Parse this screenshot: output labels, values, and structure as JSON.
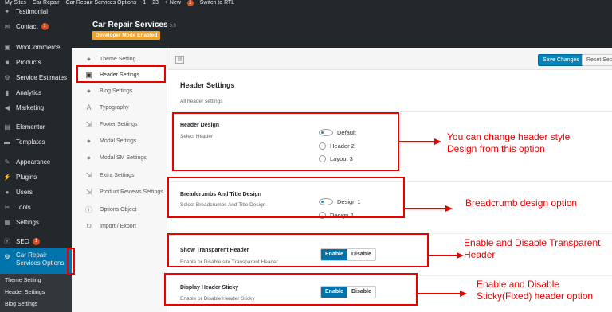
{
  "admin_bar": {
    "items": [
      "My Sites",
      "Car Repair",
      "Car Repair Services Options",
      "1",
      "23",
      "+ New",
      "1",
      "Switch to RTL"
    ]
  },
  "admin_menu": {
    "items": [
      {
        "label": "Testimonial",
        "icon": "pin-icon"
      },
      {
        "label": "Contact",
        "icon": "mail-icon",
        "badge": "1"
      },
      {
        "label": "WooCommerce",
        "icon": "woo-icon"
      },
      {
        "label": "Products",
        "icon": "products-icon"
      },
      {
        "label": "Service Estimates",
        "icon": "gear-icon"
      },
      {
        "label": "Analytics",
        "icon": "analytics-icon"
      },
      {
        "label": "Marketing",
        "icon": "megaphone-icon"
      },
      {
        "label": "Elementor",
        "icon": "elementor-icon"
      },
      {
        "label": "Templates",
        "icon": "folder-icon"
      },
      {
        "label": "Appearance",
        "icon": "brush-icon"
      },
      {
        "label": "Plugins",
        "icon": "plugin-icon"
      },
      {
        "label": "Users",
        "icon": "user-icon"
      },
      {
        "label": "Tools",
        "icon": "wrench-icon"
      },
      {
        "label": "Settings",
        "icon": "settings-icon"
      },
      {
        "label": "SEO",
        "icon": "seo-icon",
        "badge": "1"
      }
    ],
    "active": {
      "label": "Car Repair Services Options",
      "icon": "gear-icon"
    },
    "submenu": [
      "Theme Setting",
      "Header Settings",
      "Blog Settings"
    ]
  },
  "panel": {
    "title": "Car Repair Services",
    "version": "3.0",
    "dev_mode": "Developer Mode Enabled"
  },
  "sidebar": {
    "items": [
      {
        "label": "Theme Setting",
        "icon": "circle-icon"
      },
      {
        "label": "Header Settings",
        "icon": "header-icon"
      },
      {
        "label": "Blog Settings",
        "icon": "circle-icon"
      },
      {
        "label": "Typography",
        "icon": "typography-icon"
      },
      {
        "label": "Footer Settings",
        "icon": "footer-icon"
      },
      {
        "label": "Modal Settings",
        "icon": "circle-icon"
      },
      {
        "label": "Modal SM Settings",
        "icon": "circle-icon"
      },
      {
        "label": "Extra Settings",
        "icon": "extra-icon"
      },
      {
        "label": "Product Reviews Settings",
        "icon": "reviews-icon"
      },
      {
        "label": "Options Object",
        "icon": "info-icon"
      },
      {
        "label": "Import / Export",
        "icon": "refresh-icon"
      }
    ],
    "active_index": 1
  },
  "toolbar": {
    "save_label": "Save Changes",
    "reset_label": "Reset Section"
  },
  "section": {
    "title": "Header Settings",
    "description": "All header settings"
  },
  "fields": {
    "header_design": {
      "title": "Header Design",
      "description": "Select Header",
      "options": [
        "Default",
        "Header 2",
        "Layout 3"
      ],
      "selected": "Default"
    },
    "breadcrumbs": {
      "title": "Breadcrumbs And Title Design",
      "description": "Select Breadcrumbs And Title Design",
      "options": [
        "Design 1",
        "Design 2"
      ],
      "selected": "Design 1"
    },
    "transparent_header": {
      "title": "Show Transparent Header",
      "description": "Enable or Disable site Transparent Header",
      "enable_label": "Enable",
      "disable_label": "Disable",
      "value": "Enable"
    },
    "sticky_header": {
      "title": "Display Header Sticky",
      "description": "Enable or Disable Header Sticky",
      "enable_label": "Enable",
      "disable_label": "Disable",
      "value": "Enable"
    }
  },
  "annotations": {
    "header_style_line1": "You can change header style",
    "header_style_line2": "Design from this option",
    "breadcrumb": "Breadcrumb design option",
    "transparent_line1": "Enable and Disable Transparent",
    "transparent_line2": "Header",
    "sticky_line1": "Enable and Disable",
    "sticky_line2": "Sticky(Fixed) header option"
  },
  "colors": {
    "admin_dark": "#23282d",
    "accent_blue": "#0073aa",
    "annotation_red": "#e00000",
    "dev_badge": "#f0a22e"
  }
}
